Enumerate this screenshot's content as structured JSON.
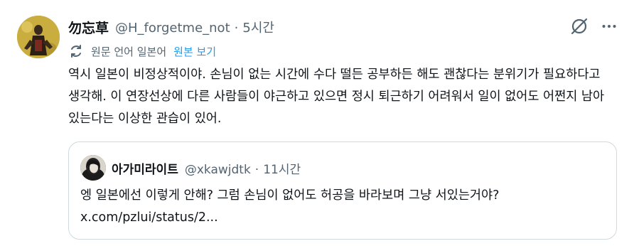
{
  "tweet": {
    "display_name": "勿忘草",
    "handle": "@H_forgetme_not",
    "separator": "·",
    "time": "5시간",
    "translation": {
      "label": "원문 언어 일본어",
      "show_original": "원본 보기"
    },
    "text": "역시 일본이 비정상적이야. 손님이 없는 시간에 수다 떨든 공부하든 해도 괜찮다는 분위기가 필요하다고 생각해. 이 연장선상에 다른 사람들이 야근하고 있으면 정시 퇴근하기 어려워서 일이 없어도 어쩐지 남아 있는다는 이상한 관습이 있어."
  },
  "quoted": {
    "display_name": "아가미라이트",
    "handle": "@xkawjdtk",
    "separator": "·",
    "time": "11시간",
    "text": "엥 일본에선 이렇게 안해? 그럼 손님이 없어도 허공을 바라보며 그냥 서있는거야?",
    "link": "x.com/pzlui/status/2..."
  },
  "icons": {
    "grok": "grok-slash-icon",
    "more": "more-dots-icon",
    "translate": "translate-icon"
  },
  "colors": {
    "link_blue": "#1d9bf0",
    "secondary_text": "#536471",
    "border": "#cfd9de"
  }
}
